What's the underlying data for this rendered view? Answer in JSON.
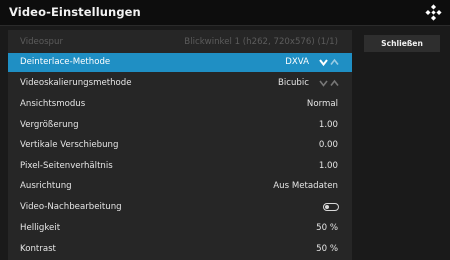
{
  "dialog": {
    "title": "Video-Einstellungen",
    "logo_icon": "kodi-logo-icon"
  },
  "settings": {
    "items": [
      {
        "label": "Videospur",
        "value": "Blickwinkel 1 (h262, 720x576) (1/1)",
        "state": "disabled"
      },
      {
        "label": "Deinterlace-Methode",
        "value": "DXVA",
        "state": "selected",
        "control": "spinner"
      },
      {
        "label": "Videoskalierungsmethode",
        "value": "Bicubic",
        "state": "normal",
        "control": "spinner"
      },
      {
        "label": "Ansichtsmodus",
        "value": "Normal",
        "state": "normal"
      },
      {
        "label": "Vergrößerung",
        "value": "1.00",
        "state": "normal"
      },
      {
        "label": "Vertikale Verschiebung",
        "value": "0.00",
        "state": "normal"
      },
      {
        "label": "Pixel-Seitenverhältnis",
        "value": "1.00",
        "state": "normal"
      },
      {
        "label": "Ausrichtung",
        "value": "Aus Metadaten",
        "state": "normal"
      },
      {
        "label": "Video-Nachbearbeitung",
        "value": null,
        "state": "normal",
        "control": "toggle",
        "toggle_on": false
      },
      {
        "label": "Helligkeit",
        "value": "50 %",
        "state": "normal"
      },
      {
        "label": "Kontrast",
        "value": "50 %",
        "state": "normal"
      }
    ]
  },
  "side_buttons": {
    "close_label": "Schließen"
  },
  "colors": {
    "accent": "#1f8fc4",
    "background": "#1a1a1a",
    "panel": "#262626",
    "disabled_text": "#5c5c5c"
  }
}
